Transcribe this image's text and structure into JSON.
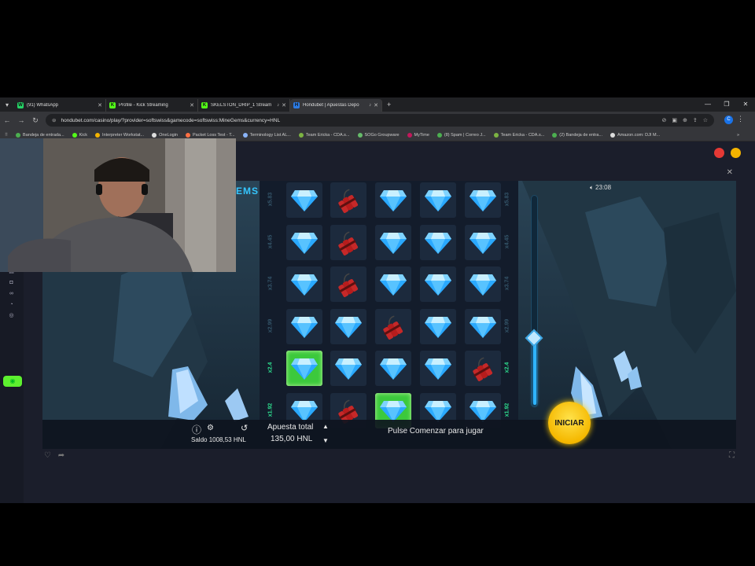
{
  "browser": {
    "tabs": [
      {
        "title": "(91) WhatsApp",
        "color": "#25d366",
        "glyph": "W"
      },
      {
        "title": "Profile - Kick Streaming",
        "color": "#53fc18",
        "glyph": "K"
      },
      {
        "title": "SKELSTON_DRIP_1 Stream",
        "color": "#53fc18",
        "glyph": "K"
      },
      {
        "title": "Hondubet | Apuestas Depo",
        "color": "#2b7be4",
        "glyph": "H"
      }
    ],
    "url": "hondubet.com/casino/play/?provider=softswiss&gamecode=softswiss:MineGems&currency=HNL",
    "profile_initial": "C",
    "bookmarks": [
      {
        "label": "Bandeja de entrada...",
        "color": "#4caf50"
      },
      {
        "label": "Kick",
        "color": "#53fc18"
      },
      {
        "label": "Interpreter Workstat...",
        "color": "#f4b400"
      },
      {
        "label": "OneLogin",
        "color": "#ddd"
      },
      {
        "label": "Packet Loss Test - T...",
        "color": "#ff7043"
      },
      {
        "label": "Terminology List AL...",
        "color": "#8ab4f8"
      },
      {
        "label": "Team Ericka - CDA.s...",
        "color": "#7cb342"
      },
      {
        "label": "SOGo Groupware",
        "color": "#66bb6a"
      },
      {
        "label": "MyTime",
        "color": "#c2185b"
      },
      {
        "label": "(8) Spam | Correo J...",
        "color": "#4caf50"
      },
      {
        "label": "Team Ericka - CDA.s...",
        "color": "#7cb342"
      },
      {
        "label": "(2) Bandeja de entra...",
        "color": "#4caf50"
      },
      {
        "label": "Amazon.com: DJI M...",
        "color": "#ddd"
      }
    ]
  },
  "game": {
    "title_fragment": "EMS",
    "time": "23:08",
    "multipliers_left": [
      "x5.83",
      "x4.45",
      "x3.74",
      "x2.99",
      "x2.4",
      "x1.92"
    ],
    "multipliers_right": [
      "x5.83",
      "x4.45",
      "x3.74",
      "x2.99",
      "x2.4",
      "x1.92"
    ],
    "highlight_row": 4,
    "grid": [
      [
        "gem",
        "bomb",
        "gem",
        "gem",
        "gem"
      ],
      [
        "gem",
        "bomb",
        "gem",
        "gem",
        "gem"
      ],
      [
        "gem",
        "bomb",
        "gem",
        "gem",
        "gem"
      ],
      [
        "gem",
        "gem",
        "bomb",
        "gem",
        "gem"
      ],
      [
        "gem-selected",
        "gem",
        "gem",
        "gem",
        "bomb"
      ],
      [
        "gem",
        "bomb",
        "gem-selected",
        "gem",
        "gem"
      ]
    ],
    "saldo_label": "Saldo",
    "saldo_value": "1008,53 HNL",
    "bet_label": "Apuesta total",
    "bet_value": "135,00 HNL",
    "status": "Pulse Comenzar para jugar",
    "start_button": "INICIAR"
  },
  "colors": {
    "accent_green": "#5df02f",
    "gem_blue": "#35b6ff",
    "start_yellow": "#ffcc00"
  }
}
